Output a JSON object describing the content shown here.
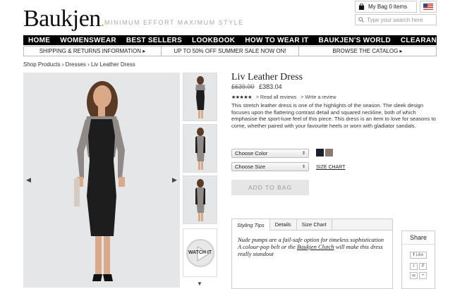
{
  "header": {
    "logo": "Baukjen",
    "tagline": "MINIMUM EFFORT MAXIMUM STYLE",
    "bag_label": "My Bag 0 items",
    "search_placeholder": "Type your search here"
  },
  "nav": [
    "HOME",
    "WOMENSWEAR",
    "BEST SELLERS",
    "LOOKBOOK",
    "HOW TO WEAR IT",
    "BAUKJEN'S WORLD",
    "CLEARANCE"
  ],
  "promo": [
    "SHIPPING & RETURNS INFORMATION  ▸",
    "UP TO 50% OFF SUMMER SALE NOW ON!",
    "BROWSE THE CATALOG  ▸"
  ],
  "breadcrumb": "Shop Products › Dresses › Liv Leather Dress",
  "gallery": {
    "watch_label": "WATCH IT"
  },
  "product": {
    "title": "Liv Leather Dress",
    "old_price": "£639.00",
    "new_price": "£383.04",
    "stars": "★★★★★",
    "read_reviews": "> Read all reviews",
    "write_review": "> Write a review",
    "description": "This stretch leather dress is one of the highlights of the season. The sleek design focuses upon the flattering contrast detail and squared neckline, both of which emphasise the sport-luxe feel of this piece. This dress is an item to love for seasons to come, whether paired with your favourite heels or worn with gladiator sandals.",
    "color_select": "Choose Color",
    "size_select": "Choose Size",
    "size_chart": "SIZE CHART",
    "add_to_bag": "ADD TO BAG",
    "swatches": [
      "#1b1e2b",
      "#8a7a72"
    ]
  },
  "tabs": {
    "labels": [
      "Styling Tips",
      "Details",
      "Size Chart"
    ],
    "line1": "Nude pumps are a fail-safe option for timeless sophistication",
    "line2a": "A colour-pop belt or the ",
    "link": "Baukjen Clutch",
    "line2b": " will make this dress really standout"
  },
  "share": {
    "title": "Share",
    "like": "Like"
  }
}
